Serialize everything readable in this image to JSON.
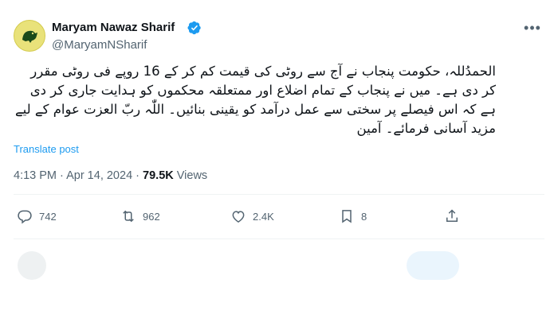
{
  "author": {
    "display_name": "Maryam Nawaz Sharif",
    "handle": "@MaryamNSharif",
    "verified": true,
    "accent": "#1d9bf0"
  },
  "tweet": {
    "text": "الحمدُللہ، حکومت پنجاب نے آج سے روٹی کی قیمت کم کر کے 16 روپے فی روٹی مقرر کر دی ہے۔ میں نے پنجاب کے تمام اضلاع اور ممتعلقہ محکموں کو ہدایت جاری کر دی ہے کہ اس فیصلے پر سختی سے عمل درآمد کو یقینی بنائیں۔ اللّٰہ ربّ العزت عوام کے لیے مزید آسانی فرمائے۔ آمین",
    "translate_label": "Translate post",
    "time": "4:13 PM",
    "date": "Apr 14, 2024",
    "views_count": "79.5K",
    "views_label": "Views"
  },
  "actions": {
    "replies": "742",
    "reposts": "962",
    "likes": "2.4K",
    "bookmarks": "8"
  },
  "icons": [
    "verified-icon",
    "more-icon",
    "reply-icon",
    "repost-icon",
    "like-icon",
    "bookmark-icon",
    "share-icon"
  ]
}
